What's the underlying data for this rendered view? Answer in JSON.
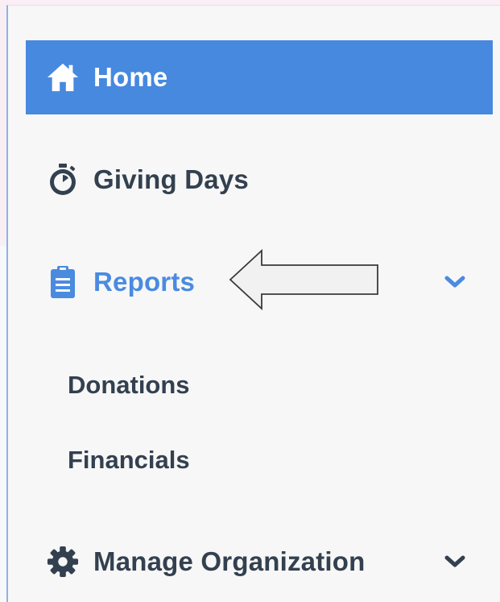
{
  "nav": {
    "home": {
      "label": "Home",
      "icon": "home-icon"
    },
    "giving_days": {
      "label": "Giving Days",
      "icon": "stopwatch-icon"
    },
    "reports": {
      "label": "Reports",
      "icon": "clipboard-icon",
      "expanded": true,
      "sub_items": [
        {
          "label": "Donations"
        },
        {
          "label": "Financials"
        }
      ]
    },
    "manage_organization": {
      "label": "Manage Organization",
      "icon": "gear-icon"
    }
  },
  "colors": {
    "active_bg": "#4689df",
    "accent": "#4a8be0",
    "text": "#33404f",
    "panel_bg": "#f7f7f7"
  }
}
